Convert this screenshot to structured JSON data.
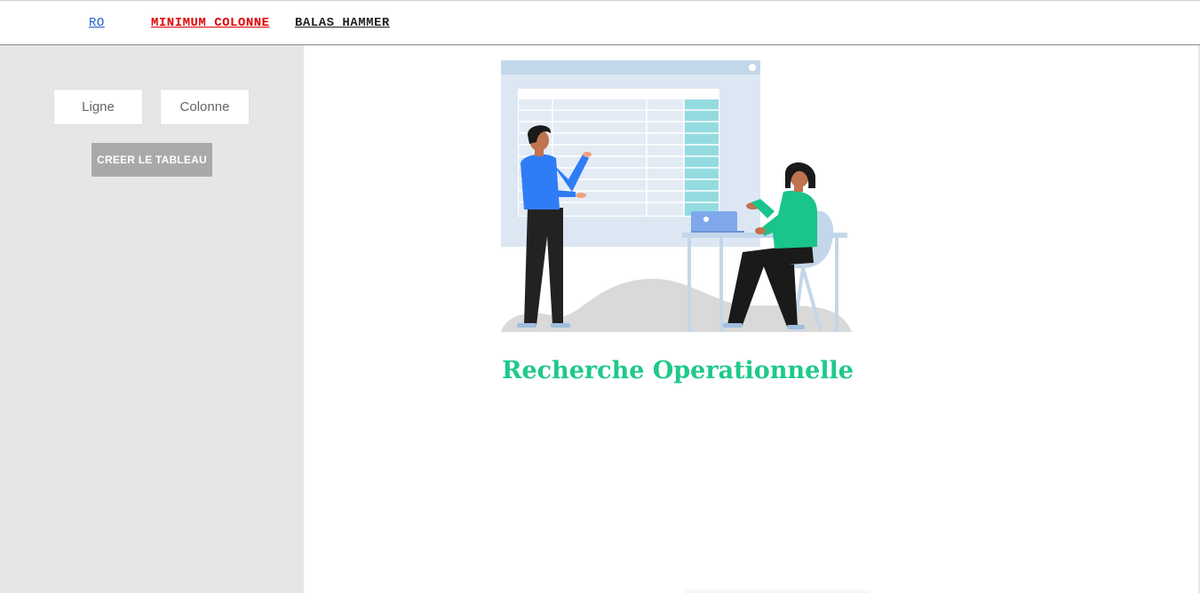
{
  "nav": {
    "items": [
      {
        "label": "RO",
        "color": "#1a5fd0"
      },
      {
        "label": "MINIMUM COLONNE",
        "color": "#e00000"
      },
      {
        "label": "BALAS HAMMER",
        "color": "#222222"
      }
    ]
  },
  "form": {
    "ligne_placeholder": "Ligne",
    "colonne_placeholder": "Colonne",
    "create_button_label": "CREER LE TABLEAU"
  },
  "main": {
    "title": "Recherche Operationnelle",
    "title_color": "#1ec98a",
    "illustration_icon": "spreadsheet-meeting-illustration"
  },
  "colors": {
    "sidebar_bg": "#e7e6e4",
    "button_bg": "#a9a9a9",
    "accent_teal": "#94dbe0",
    "shirt_blue": "#2f7df6",
    "shirt_green": "#19c58a"
  }
}
